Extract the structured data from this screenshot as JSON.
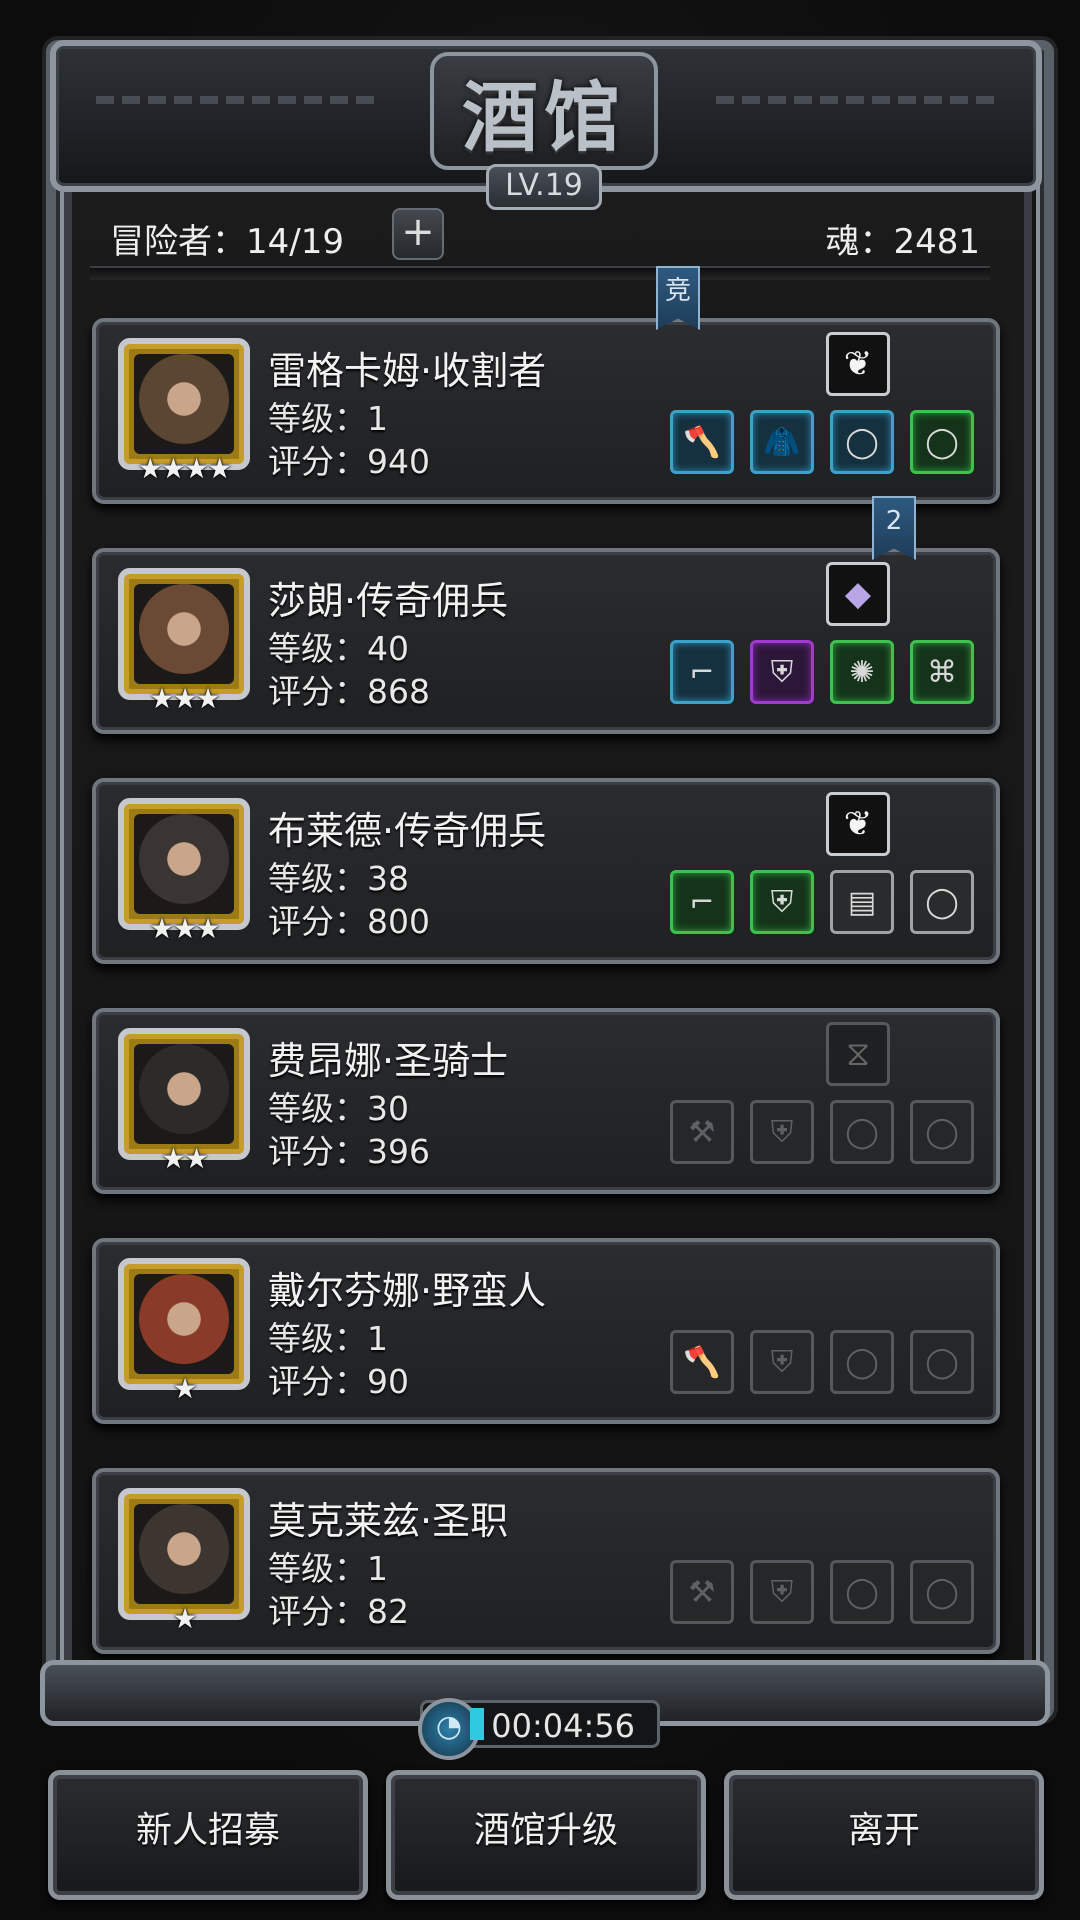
{
  "header": {
    "title": "酒馆",
    "level_badge": "LV.19"
  },
  "stats": {
    "adventurers": "冒险者：14/19",
    "plus": "+",
    "soul": "魂：2481"
  },
  "ribbons": {
    "arena": "竞",
    "second": "2"
  },
  "heroes": [
    {
      "name": "雷格卡姆·收割者",
      "level": "等级：1",
      "score": "评分：940",
      "stars": "★★★★",
      "skill_icon": "feather-icon",
      "skill_symbol": "❦",
      "portrait_color": "#5a4632",
      "equipment": [
        {
          "icon": "battle-axe-icon",
          "symbol": "🪓",
          "rarity": "blue"
        },
        {
          "icon": "leather-armor-icon",
          "symbol": "🧥",
          "rarity": "blue"
        },
        {
          "icon": "ring-icon",
          "symbol": "◯",
          "rarity": "blue"
        },
        {
          "icon": "ring-icon",
          "symbol": "◯",
          "rarity": "green"
        }
      ]
    },
    {
      "name": "莎朗·传奇佣兵",
      "level": "等级：40",
      "score": "评分：868",
      "stars": "★★★",
      "skill_icon": "crystal-icon",
      "skill_symbol": "◆",
      "portrait_color": "#6b4a35",
      "equipment": [
        {
          "icon": "pistol-icon",
          "symbol": "⌐",
          "rarity": "blue"
        },
        {
          "icon": "plate-armor-icon",
          "symbol": "⛨",
          "rarity": "purple"
        },
        {
          "icon": "amulet-icon",
          "symbol": "✺",
          "rarity": "green"
        },
        {
          "icon": "scroll-icon",
          "symbol": "⌘",
          "rarity": "green"
        }
      ]
    },
    {
      "name": "布莱德·传奇佣兵",
      "level": "等级：38",
      "score": "评分：800",
      "stars": "★★★",
      "skill_icon": "feather-icon",
      "skill_symbol": "❦",
      "portrait_color": "#3a3532",
      "equipment": [
        {
          "icon": "pistol-icon",
          "symbol": "⌐",
          "rarity": "green"
        },
        {
          "icon": "plate-armor-icon",
          "symbol": "⛨",
          "rarity": "green"
        },
        {
          "icon": "barrel-icon",
          "symbol": "▤",
          "rarity": "grey"
        },
        {
          "icon": "ring-icon",
          "symbol": "◯",
          "rarity": "grey"
        }
      ]
    },
    {
      "name": "费昂娜·圣骑士",
      "level": "等级：30",
      "score": "评分：396",
      "stars": "★★",
      "skill_icon": "hourglass-icon",
      "skill_symbol": "⧖",
      "portrait_color": "#2d2a2a",
      "equipment": [
        {
          "icon": "hammer-icon",
          "symbol": "⚒",
          "rarity": "empty"
        },
        {
          "icon": "armor-icon",
          "symbol": "⛨",
          "rarity": "empty"
        },
        {
          "icon": "ring-icon",
          "symbol": "◯",
          "rarity": "empty"
        },
        {
          "icon": "ring-icon",
          "symbol": "◯",
          "rarity": "empty"
        }
      ]
    },
    {
      "name": "戴尔芬娜·野蛮人",
      "level": "等级：1",
      "score": "评分：90",
      "stars": "★",
      "skill_icon": "",
      "skill_symbol": "",
      "portrait_color": "#8a3a28",
      "equipment": [
        {
          "icon": "axe-icon",
          "symbol": "🪓",
          "rarity": "empty"
        },
        {
          "icon": "armor-icon",
          "symbol": "⛨",
          "rarity": "empty"
        },
        {
          "icon": "ring-icon",
          "symbol": "◯",
          "rarity": "empty"
        },
        {
          "icon": "ring-icon",
          "symbol": "◯",
          "rarity": "empty"
        }
      ]
    },
    {
      "name": "莫克莱兹·圣职",
      "level": "等级：1",
      "score": "评分：82",
      "stars": "★",
      "skill_icon": "",
      "skill_symbol": "",
      "portrait_color": "#3d3530",
      "equipment": [
        {
          "icon": "hammer-icon",
          "symbol": "⚒",
          "rarity": "empty"
        },
        {
          "icon": "armor-icon",
          "symbol": "⛨",
          "rarity": "empty"
        },
        {
          "icon": "ring-icon",
          "symbol": "◯",
          "rarity": "empty"
        },
        {
          "icon": "ring-icon",
          "symbol": "◯",
          "rarity": "empty"
        }
      ]
    }
  ],
  "timer": {
    "value": "00:04:56",
    "clock_symbol": "◔"
  },
  "buttons": {
    "recruit": "新人招募",
    "upgrade": "酒馆升级",
    "leave": "离开"
  }
}
